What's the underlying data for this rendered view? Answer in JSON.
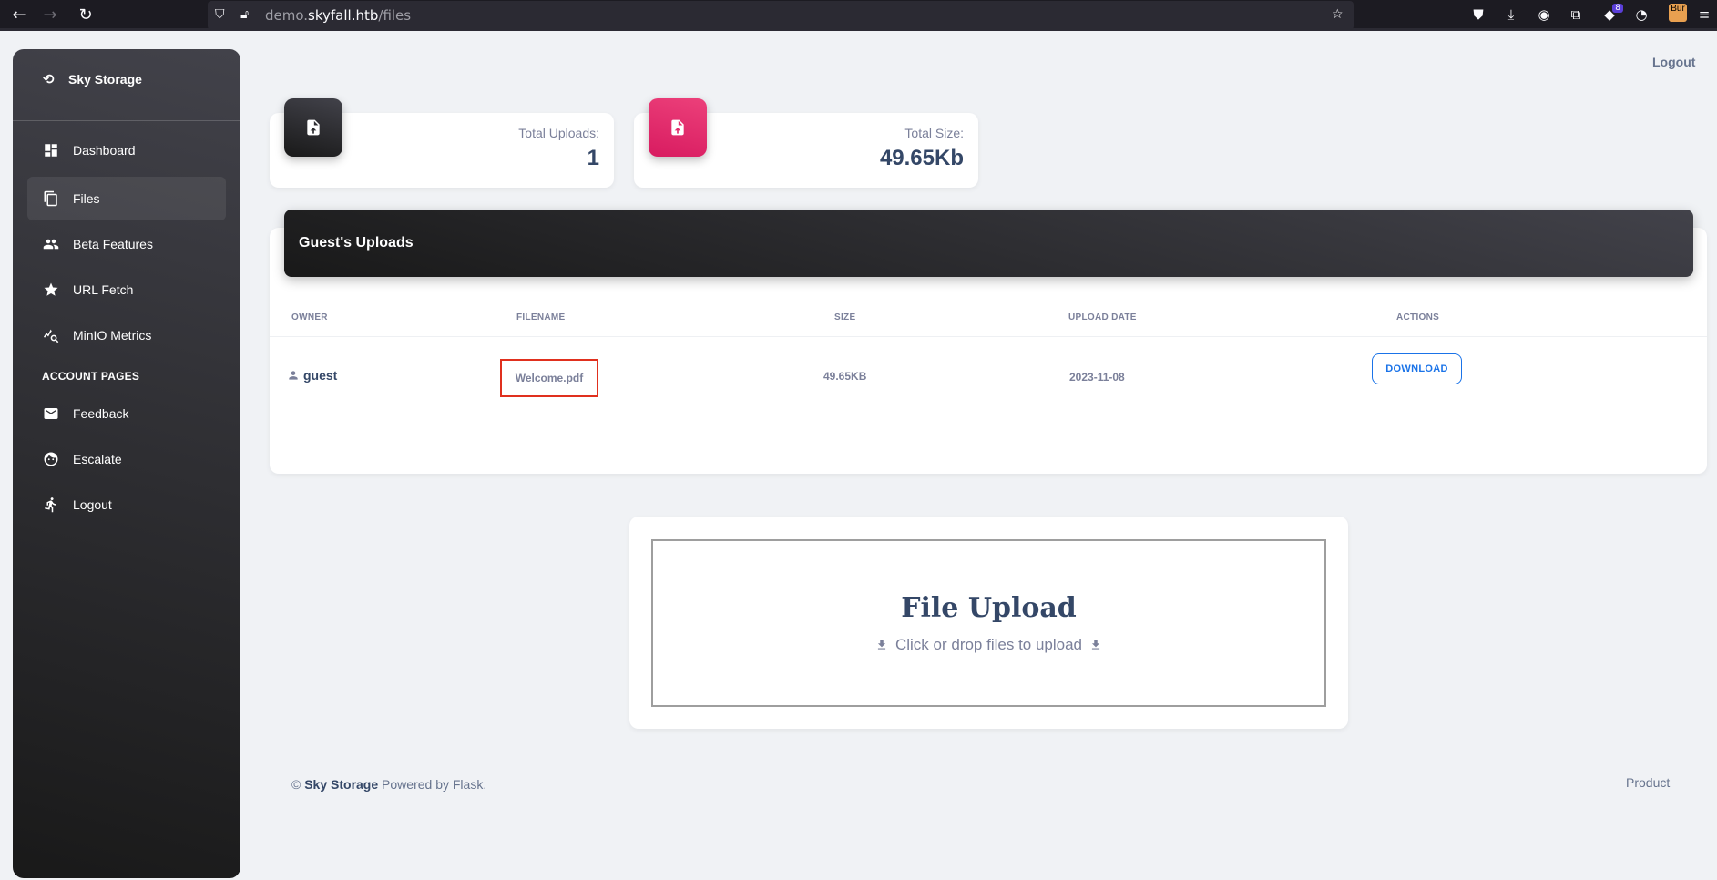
{
  "browser": {
    "url_prefix": "demo.",
    "url_domain": "skyfall.htb",
    "url_path": "/files",
    "ext_badge": "8",
    "ext_bur": "Bur"
  },
  "sidebar": {
    "brand": "Sky Storage",
    "items": [
      {
        "label": "Dashboard"
      },
      {
        "label": "Files"
      },
      {
        "label": "Beta Features"
      },
      {
        "label": "URL Fetch"
      },
      {
        "label": "MinIO Metrics"
      }
    ],
    "account_header": "ACCOUNT PAGES",
    "account_items": [
      {
        "label": "Feedback"
      },
      {
        "label": "Escalate"
      },
      {
        "label": "Logout"
      }
    ]
  },
  "topbar": {
    "logout": "Logout"
  },
  "stats": {
    "uploads_label": "Total Uploads:",
    "uploads_value": "1",
    "size_label": "Total Size:",
    "size_value": "49.65Kb"
  },
  "uploads": {
    "title": "Guest's Uploads",
    "columns": [
      "OWNER",
      "FILENAME",
      "SIZE",
      "UPLOAD DATE",
      "ACTIONS"
    ],
    "rows": [
      {
        "owner": "guest",
        "filename": "Welcome.pdf",
        "size": "49.65KB",
        "date": "2023-11-08",
        "action": "DOWNLOAD"
      }
    ]
  },
  "file_upload": {
    "title": "File Upload",
    "subtitle": "Click or drop files to upload"
  },
  "footer": {
    "copyright": "©",
    "brand": "Sky Storage",
    "powered": "Powered by Flask.",
    "right_link": "Product"
  }
}
